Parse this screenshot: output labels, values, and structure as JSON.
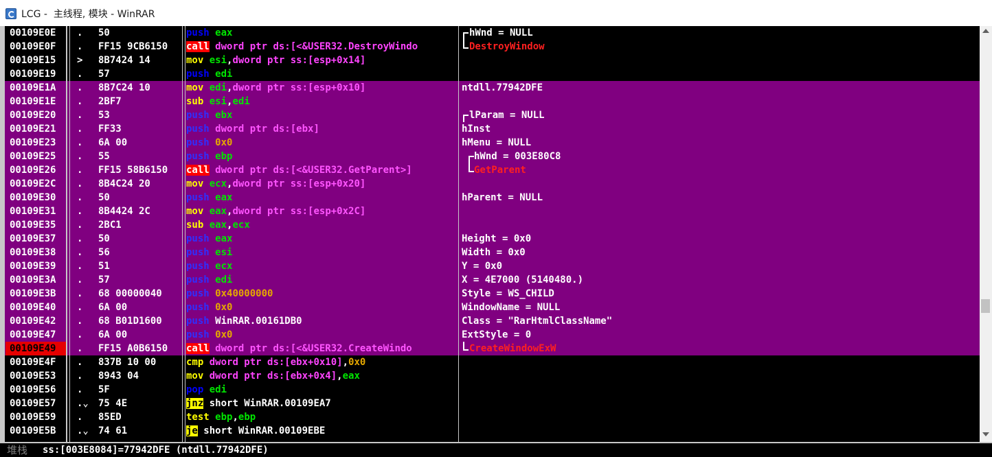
{
  "window": {
    "title": "LCG -  主线程, 模块 - WinRAR"
  },
  "colors": {
    "highlight": "#800080",
    "current": "#e60000",
    "call": "#ff0000",
    "jump": "#ffff00"
  },
  "rows": [
    {
      "addr": "00109E0E",
      "mark": ".",
      "hex": "50",
      "hl": false,
      "mnem": "push",
      "kind": "push",
      "ops": [
        [
          "eax",
          "r"
        ]
      ],
      "cmt": "hWnd = NULL",
      "br": "top"
    },
    {
      "addr": "00109E0F",
      "mark": ".",
      "hex": "FF15 9CB6150",
      "hl": false,
      "mnem": "call",
      "kind": "call",
      "ops": [
        [
          "dword ptr ds:[<&USER32.DestroyWindo",
          "m"
        ]
      ],
      "cmt": "DestroyWindow",
      "api": true,
      "br": "bot"
    },
    {
      "addr": "00109E15",
      "mark": ">",
      "hex": "8B7424 14",
      "hl": false,
      "mnem": "mov",
      "kind": "mov",
      "ops": [
        [
          "esi",
          "r"
        ],
        [
          ",",
          "t"
        ],
        [
          "dword ptr ss:[esp+0x14]",
          "m"
        ]
      ],
      "cmt": ""
    },
    {
      "addr": "00109E19",
      "mark": ".",
      "hex": "57",
      "hl": false,
      "mnem": "push",
      "kind": "push",
      "ops": [
        [
          "edi",
          "r"
        ]
      ],
      "cmt": ""
    },
    {
      "addr": "00109E1A",
      "mark": ".",
      "hex": "8B7C24 10",
      "hl": true,
      "mnem": "mov",
      "kind": "mov",
      "ops": [
        [
          "edi",
          "r"
        ],
        [
          ",",
          "t"
        ],
        [
          "dword ptr ss:[esp+0x10]",
          "m"
        ]
      ],
      "cmt": "ntdll.77942DFE"
    },
    {
      "addr": "00109E1E",
      "mark": ".",
      "hex": "2BF7",
      "hl": true,
      "mnem": "sub",
      "kind": "sub",
      "ops": [
        [
          "esi",
          "r"
        ],
        [
          ",",
          "t"
        ],
        [
          "edi",
          "r"
        ]
      ],
      "cmt": ""
    },
    {
      "addr": "00109E20",
      "mark": ".",
      "hex": "53",
      "hl": true,
      "mnem": "push",
      "kind": "push",
      "ops": [
        [
          "ebx",
          "r"
        ]
      ],
      "cmt": "lParam = NULL",
      "br": "top"
    },
    {
      "addr": "00109E21",
      "mark": ".",
      "hex": "FF33",
      "hl": true,
      "mnem": "push",
      "kind": "push",
      "ops": [
        [
          "dword ptr ds:[ebx]",
          "m"
        ]
      ],
      "cmt": "hInst"
    },
    {
      "addr": "00109E23",
      "mark": ".",
      "hex": "6A 00",
      "hl": true,
      "mnem": "push",
      "kind": "push",
      "ops": [
        [
          "0x0",
          "i"
        ]
      ],
      "cmt": "hMenu = NULL"
    },
    {
      "addr": "00109E25",
      "mark": ".",
      "hex": "55",
      "hl": true,
      "mnem": "push",
      "kind": "push",
      "ops": [
        [
          "ebp",
          "r"
        ]
      ],
      "cmt": "hWnd = 003E80C8",
      "br": "top2"
    },
    {
      "addr": "00109E26",
      "mark": ".",
      "hex": "FF15 58B6150",
      "hl": true,
      "mnem": "call",
      "kind": "call",
      "ops": [
        [
          "dword ptr ds:[<&USER32.GetParent>]",
          "m"
        ]
      ],
      "cmt": "GetParent",
      "api": true,
      "br": "bot2"
    },
    {
      "addr": "00109E2C",
      "mark": ".",
      "hex": "8B4C24 20",
      "hl": true,
      "mnem": "mov",
      "kind": "mov",
      "ops": [
        [
          "ecx",
          "r"
        ],
        [
          ",",
          "t"
        ],
        [
          "dword ptr ss:[esp+0x20]",
          "m"
        ]
      ],
      "cmt": ""
    },
    {
      "addr": "00109E30",
      "mark": ".",
      "hex": "50",
      "hl": true,
      "mnem": "push",
      "kind": "push",
      "ops": [
        [
          "eax",
          "r"
        ]
      ],
      "cmt": "hParent = NULL"
    },
    {
      "addr": "00109E31",
      "mark": ".",
      "hex": "8B4424 2C",
      "hl": true,
      "mnem": "mov",
      "kind": "mov",
      "ops": [
        [
          "eax",
          "r"
        ],
        [
          ",",
          "t"
        ],
        [
          "dword ptr ss:[esp+0x2C]",
          "m"
        ]
      ],
      "cmt": ""
    },
    {
      "addr": "00109E35",
      "mark": ".",
      "hex": "2BC1",
      "hl": true,
      "mnem": "sub",
      "kind": "sub",
      "ops": [
        [
          "eax",
          "r"
        ],
        [
          ",",
          "t"
        ],
        [
          "ecx",
          "r"
        ]
      ],
      "cmt": ""
    },
    {
      "addr": "00109E37",
      "mark": ".",
      "hex": "50",
      "hl": true,
      "mnem": "push",
      "kind": "push",
      "ops": [
        [
          "eax",
          "r"
        ]
      ],
      "cmt": "Height = 0x0"
    },
    {
      "addr": "00109E38",
      "mark": ".",
      "hex": "56",
      "hl": true,
      "mnem": "push",
      "kind": "push",
      "ops": [
        [
          "esi",
          "r"
        ]
      ],
      "cmt": "Width = 0x0"
    },
    {
      "addr": "00109E39",
      "mark": ".",
      "hex": "51",
      "hl": true,
      "mnem": "push",
      "kind": "push",
      "ops": [
        [
          "ecx",
          "r"
        ]
      ],
      "cmt": "Y = 0x0"
    },
    {
      "addr": "00109E3A",
      "mark": ".",
      "hex": "57",
      "hl": true,
      "mnem": "push",
      "kind": "push",
      "ops": [
        [
          "edi",
          "r"
        ]
      ],
      "cmt": "X = 4E7000 (5140480.)"
    },
    {
      "addr": "00109E3B",
      "mark": ".",
      "hex": "68 00000040",
      "hl": true,
      "mnem": "push",
      "kind": "push",
      "ops": [
        [
          "0x40000000",
          "i"
        ]
      ],
      "cmt": "Style = WS_CHILD"
    },
    {
      "addr": "00109E40",
      "mark": ".",
      "hex": "6A 00",
      "hl": true,
      "mnem": "push",
      "kind": "push",
      "ops": [
        [
          "0x0",
          "i"
        ]
      ],
      "cmt": "WindowName = NULL"
    },
    {
      "addr": "00109E42",
      "mark": ".",
      "hex": "68 B01D1600",
      "hl": true,
      "mnem": "push",
      "kind": "push",
      "ops": [
        [
          "WinRAR.00161DB0",
          "t"
        ]
      ],
      "cmt": "Class = \"RarHtmlClassName\""
    },
    {
      "addr": "00109E47",
      "mark": ".",
      "hex": "6A 00",
      "hl": true,
      "mnem": "push",
      "kind": "push",
      "ops": [
        [
          "0x0",
          "i"
        ]
      ],
      "cmt": "ExtStyle = 0"
    },
    {
      "addr": "00109E49",
      "mark": ".",
      "hex": "FF15 A0B6150",
      "hl": true,
      "cur": true,
      "mnem": "call",
      "kind": "call",
      "ops": [
        [
          "dword ptr ds:[<&USER32.CreateWindo",
          "m"
        ]
      ],
      "cmt": "CreateWindowExW",
      "api": true,
      "br": "bot"
    },
    {
      "addr": "00109E4F",
      "mark": ".",
      "hex": "837B 10 00",
      "hl": false,
      "mnem": "cmp",
      "kind": "cmp",
      "ops": [
        [
          "dword ptr ds:[ebx+0x10]",
          "m"
        ],
        [
          ",",
          "t"
        ],
        [
          "0x0",
          "i"
        ]
      ],
      "cmt": ""
    },
    {
      "addr": "00109E53",
      "mark": ".",
      "hex": "8943 04",
      "hl": false,
      "mnem": "mov",
      "kind": "mov",
      "ops": [
        [
          "dword ptr ds:[ebx+0x4]",
          "m"
        ],
        [
          ",",
          "t"
        ],
        [
          "eax",
          "r"
        ]
      ],
      "cmt": ""
    },
    {
      "addr": "00109E56",
      "mark": ".",
      "hex": "5F",
      "hl": false,
      "mnem": "pop",
      "kind": "pop",
      "ops": [
        [
          "edi",
          "r"
        ]
      ],
      "cmt": ""
    },
    {
      "addr": "00109E57",
      "mark": ".⌄",
      "hex": "75 4E",
      "hl": false,
      "mnem": "jnz",
      "kind": "jcc",
      "ops": [
        [
          "short WinRAR.00109EA7",
          "t"
        ]
      ],
      "cmt": ""
    },
    {
      "addr": "00109E59",
      "mark": ".",
      "hex": "85ED",
      "hl": false,
      "mnem": "test",
      "kind": "test",
      "ops": [
        [
          "ebp",
          "r"
        ],
        [
          ",",
          "t"
        ],
        [
          "ebp",
          "r"
        ]
      ],
      "cmt": ""
    },
    {
      "addr": "00109E5B",
      "mark": ".⌄",
      "hex": "74 61",
      "hl": false,
      "mnem": "je",
      "kind": "jcc",
      "ops": [
        [
          "short WinRAR.00109EBE",
          "t"
        ]
      ],
      "cmt": ""
    }
  ],
  "infobar": {
    "label": "堆栈",
    "text": "ss:[003E8084]=77942DFE (ntdll.77942DFE)"
  }
}
